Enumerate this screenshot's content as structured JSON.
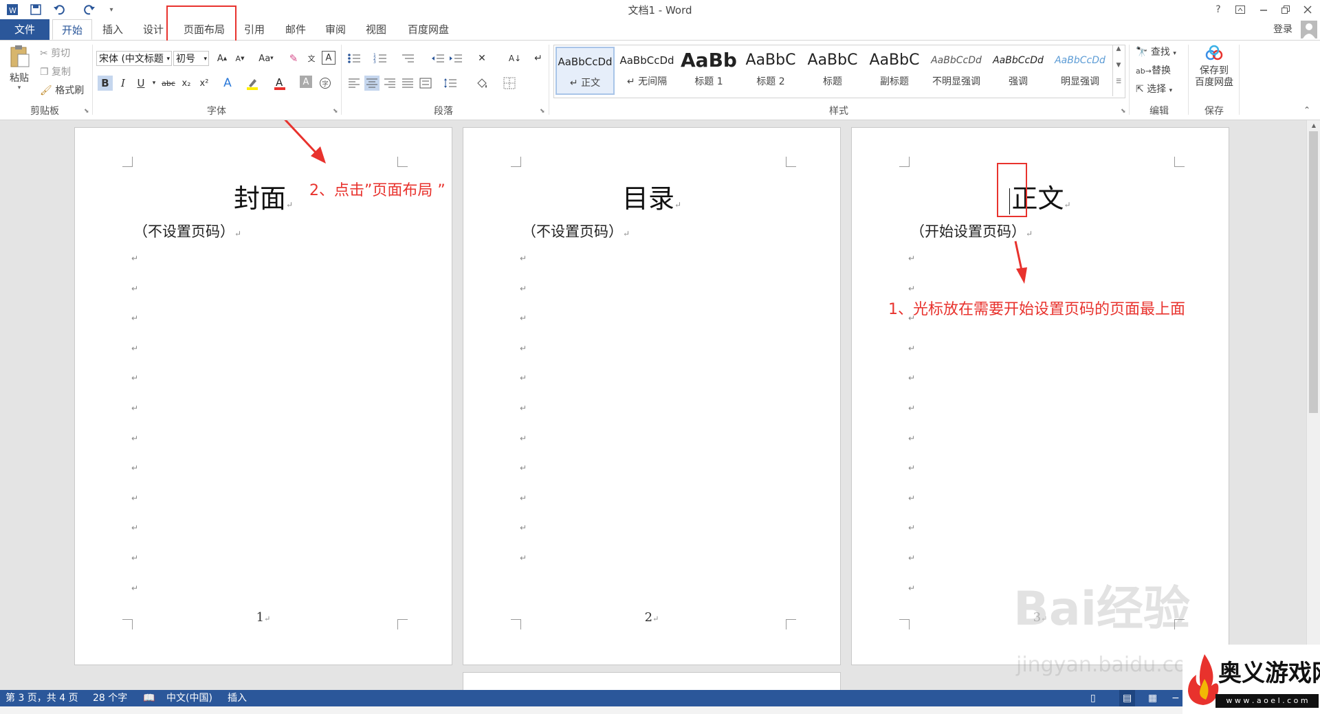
{
  "window": {
    "title": "文档1 - Word",
    "help": "?",
    "signin": "登录"
  },
  "tabs": [
    "文件",
    "开始",
    "插入",
    "设计",
    "页面布局",
    "引用",
    "邮件",
    "审阅",
    "视图",
    "百度网盘"
  ],
  "clipboard": {
    "paste": "粘贴",
    "cut": "剪切",
    "copy": "复制",
    "format_painter": "格式刷",
    "label": "剪贴板"
  },
  "font": {
    "name": "宋体 (中文标题",
    "size": "初号",
    "case_label": "Aa",
    "label": "字体",
    "bold": "B",
    "italic": "I",
    "underline": "U",
    "strike": "abc",
    "subscript": "x₂",
    "superscript": "x²"
  },
  "paragraph": {
    "label": "段落"
  },
  "styles": {
    "label": "样式",
    "items": [
      {
        "sample": "AaBbCcDd",
        "name": "正文"
      },
      {
        "sample": "AaBbCcDd",
        "name": "无间隔"
      },
      {
        "sample": "AaBb",
        "name": "标题 1"
      },
      {
        "sample": "AaBbC",
        "name": "标题 2"
      },
      {
        "sample": "AaBbC",
        "name": "标题"
      },
      {
        "sample": "AaBbC",
        "name": "副标题"
      },
      {
        "sample": "AaBbCcDd",
        "name": "不明显强调"
      },
      {
        "sample": "AaBbCcDd",
        "name": "强调"
      },
      {
        "sample": "AaBbCcDd",
        "name": "明显强调"
      }
    ]
  },
  "editing": {
    "find": "查找",
    "replace": "替换",
    "select": "选择",
    "label": "编辑"
  },
  "save": {
    "button_line1": "保存到",
    "button_line2": "百度网盘",
    "label": "保存"
  },
  "pages": [
    {
      "title": "封面",
      "subtitle": "（不设置页码）",
      "page_number": "1"
    },
    {
      "title": "目录",
      "subtitle": "（不设置页码）",
      "page_number": "2"
    },
    {
      "title": "正文",
      "subtitle": "（开始设置页码）",
      "page_number": "3"
    }
  ],
  "annotations": {
    "step2": "2、点击”页面布局 ”",
    "step1": "1、光标放在需要开始设置页码的页面最上面"
  },
  "status": {
    "page": "第 3 页，共 4 页",
    "words": "28 个字",
    "language": "中文(中国)",
    "mode": "插入"
  },
  "watermark": {
    "baidu": "Bai经验",
    "url": "jingyan.baidu.com",
    "site": "奥义游戏网",
    "site_url": "w w w . a o e l . c o m"
  },
  "colors": {
    "accent": "#2b579a",
    "annotation": "#e8322d"
  }
}
